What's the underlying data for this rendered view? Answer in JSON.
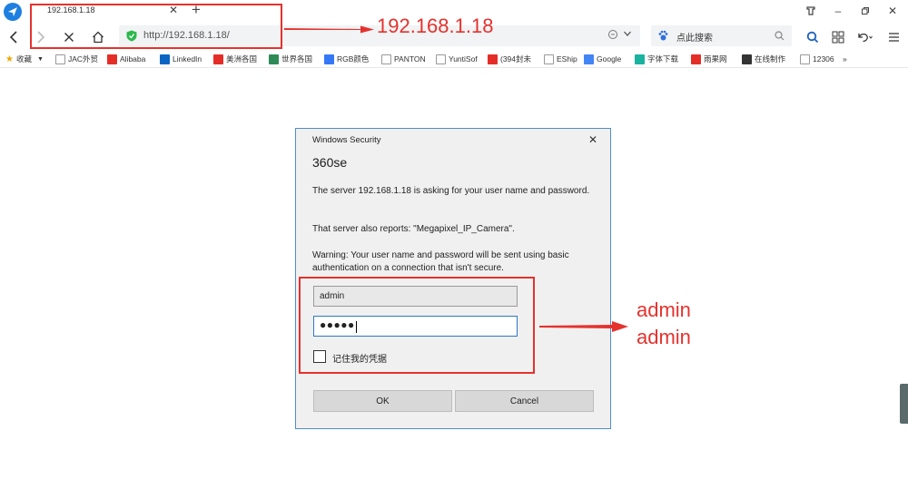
{
  "tab": {
    "title": "192.168.1.18"
  },
  "address": {
    "url": "http://192.168.1.18/"
  },
  "search": {
    "placeholder": "点此搜索"
  },
  "bookmarks": [
    {
      "label": "收藏",
      "color": "#f0a500"
    },
    {
      "label": "JAC外贸",
      "color": "#cccccc"
    },
    {
      "label": "Alibaba",
      "color": "#e52d27"
    },
    {
      "label": "LinkedIn",
      "color": "#0a66c2"
    },
    {
      "label": "美洲各国",
      "color": "#e52d27"
    },
    {
      "label": "世界各国",
      "color": "#2e8b57"
    },
    {
      "label": "RGB颜色",
      "color": "#3478f6"
    },
    {
      "label": "PANTON",
      "color": "#cccccc"
    },
    {
      "label": "YuntiSof",
      "color": "#cccccc"
    },
    {
      "label": "(394封未",
      "color": "#e52d27"
    },
    {
      "label": "EShip",
      "color": "#cccccc"
    },
    {
      "label": "Google",
      "color": "#4285f4"
    },
    {
      "label": "字体下载",
      "color": "#19b3a0"
    },
    {
      "label": "雨果网",
      "color": "#e52d27"
    },
    {
      "label": "在线制作",
      "color": "#333333"
    },
    {
      "label": "12306",
      "color": "#cccccc"
    },
    {
      "label": "»",
      "color": ""
    }
  ],
  "dialog": {
    "window_title": "Windows Security",
    "app_name": "360se",
    "message1": "The server 192.168.1.18 is asking for your user name and password.",
    "message2": "That server also reports: \"Megapixel_IP_Camera\".",
    "warning": "Warning: Your user name and password will be sent using basic authentication on a connection that isn't secure.",
    "username_value": "admin",
    "password_mask": "●●●●●",
    "remember_label": "记住我的凭据",
    "ok_label": "OK",
    "cancel_label": "Cancel"
  },
  "annotations": {
    "url_note": "192.168.1.18",
    "cred_user": "admin",
    "cred_pass": "admin"
  },
  "colors": {
    "accent": "#e5322d",
    "dialog_border": "#4e8dc9",
    "secure": "#2db84d"
  }
}
